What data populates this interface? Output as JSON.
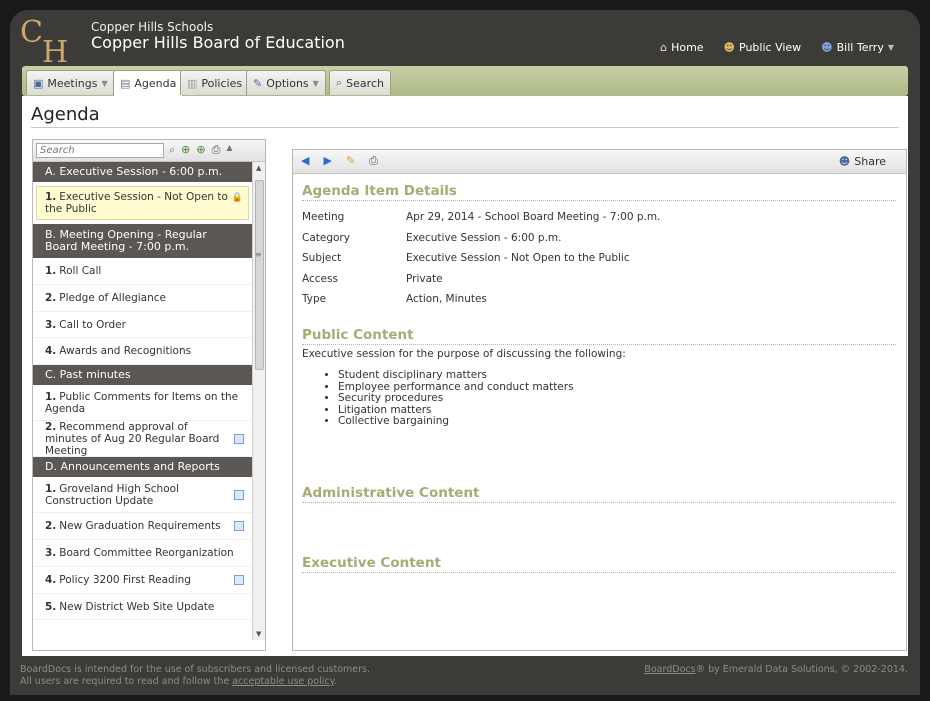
{
  "header": {
    "org_sub": "Copper Hills Schools",
    "org_main": "Copper Hills Board of Education",
    "nav": {
      "home": "Home",
      "public_view": "Public View",
      "user": "Bill Terry"
    }
  },
  "tabs": {
    "meetings": "Meetings",
    "agenda": "Agenda",
    "policies": "Policies",
    "options": "Options",
    "search": "Search"
  },
  "page_title": "Agenda",
  "left": {
    "search_placeholder": "Search",
    "categories": {
      "a": "A. Executive Session - 6:00 p.m.",
      "b": "B. Meeting Opening - Regular Board Meeting - 7:00 p.m.",
      "c": "C. Past minutes",
      "d": "D. Announcements and Reports"
    },
    "items": {
      "a1": {
        "num": "1.",
        "text": "Executive Session - Not Open to the Public"
      },
      "b1": {
        "num": "1.",
        "text": "Roll Call"
      },
      "b2": {
        "num": "2.",
        "text": "Pledge of Allegiance"
      },
      "b3": {
        "num": "3.",
        "text": "Call to Order"
      },
      "b4": {
        "num": "4.",
        "text": "Awards and Recognitions"
      },
      "c1": {
        "num": "1.",
        "text": "Public Comments for Items on the Agenda"
      },
      "c2": {
        "num": "2.",
        "text": "Recommend approval of minutes of Aug 20 Regular Board Meeting"
      },
      "d1": {
        "num": "1.",
        "text": "Groveland High School Construction Update"
      },
      "d2": {
        "num": "2.",
        "text": "New Graduation Requirements"
      },
      "d3": {
        "num": "3.",
        "text": "Board Committee Reorganization"
      },
      "d4": {
        "num": "4.",
        "text": "Policy 3200 First Reading"
      },
      "d5": {
        "num": "5.",
        "text": "New District Web Site Update"
      }
    }
  },
  "right": {
    "share": "Share",
    "details_heading": "Agenda Item Details",
    "details": {
      "meeting_label": "Meeting",
      "meeting_value": "Apr 29, 2014 - School Board Meeting - 7:00 p.m.",
      "category_label": "Category",
      "category_value": "Executive Session - 6:00 p.m.",
      "subject_label": "Subject",
      "subject_value": "Executive Session - Not Open to the Public",
      "access_label": "Access",
      "access_value": "Private",
      "type_label": "Type",
      "type_value": "Action, Minutes"
    },
    "public_heading": "Public Content",
    "public_intro": "Executive session for the purpose of discussing the following:",
    "bullets": {
      "b1": "Student disciplinary matters",
      "b2": "Employee performance and conduct matters",
      "b3": "Security procedures",
      "b4": "Litigation matters",
      "b5": "Collective bargaining"
    },
    "admin_heading": "Administrative Content",
    "exec_heading": "Executive Content"
  },
  "footer": {
    "l1": "BoardDocs is intended for the use of subscribers and licensed customers.",
    "l2_pre": "All users are required to read and follow the",
    "l2_link": "acceptable use policy",
    "l2_post": ".",
    "r_link": "BoardDocs",
    "r_text": "® by Emerald Data Solutions, © 2002-2014."
  },
  "colors": {
    "header_bg": "#3d3b38",
    "tabbar": "#aeb987",
    "category_bar": "#5a5754",
    "section_heading": "#a9aa74",
    "selected_item": "#fffbd0"
  }
}
